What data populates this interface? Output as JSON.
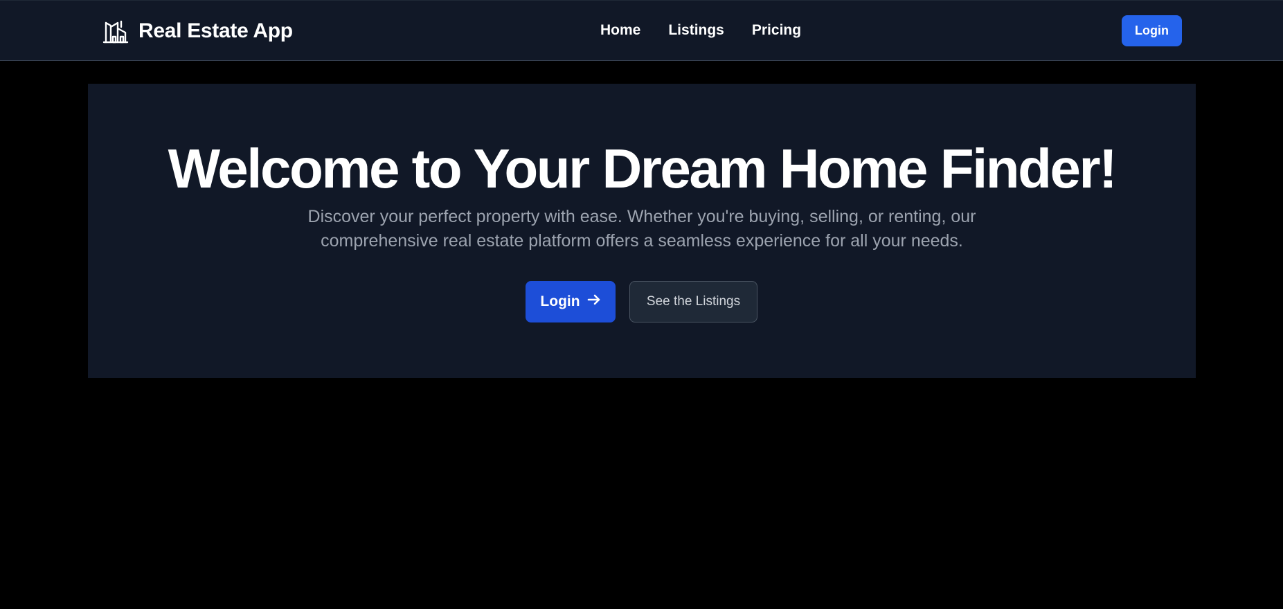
{
  "navbar": {
    "brand_title": "Real Estate App",
    "brand_icon": "building-icon",
    "links": [
      {
        "label": "Home"
      },
      {
        "label": "Listings"
      },
      {
        "label": "Pricing"
      }
    ],
    "login_label": "Login"
  },
  "hero": {
    "title": "Welcome to Your Dream Home Finder!",
    "subtitle": "Discover your perfect property with ease. Whether you're buying, selling, or renting, our comprehensive real estate platform offers a seamless experience for all your needs.",
    "primary_button": {
      "label": "Login",
      "icon": "arrow-right-icon"
    },
    "secondary_button": {
      "label": "See the Listings"
    }
  },
  "colors": {
    "page_background": "#000000",
    "surface": "#111827",
    "accent": "#2563eb",
    "accent_dark": "#1d4ed8",
    "muted_text": "#9ca3af"
  }
}
